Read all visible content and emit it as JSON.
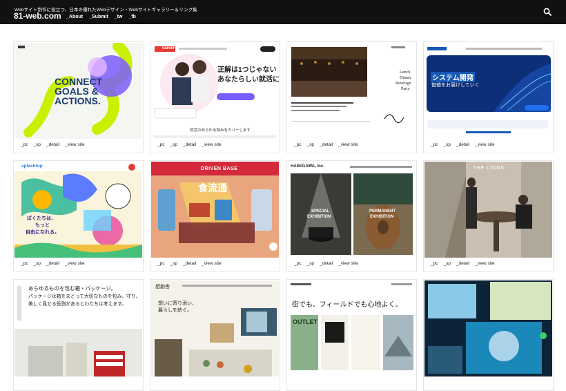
{
  "header": {
    "tagline": "Webサイト制作に役立つ、日本の優れたWebデザイン・Webサイトギャラリー＆リンク集",
    "logo": "81-web.com",
    "nav": [
      "_About",
      "_Submit",
      "_tw",
      "_fb"
    ],
    "search_icon": "search-icon"
  },
  "card_links": [
    "_pc",
    "_sp",
    "_detail",
    "_view site"
  ],
  "cards": [
    {
      "thumb_texts": [
        "CONNECT",
        "GOALS &",
        "ACTIONS."
      ]
    },
    {
      "thumb_texts": [
        "career",
        "正解は1つじゃない",
        "あなたらしい就活に",
        "就活のあらゆる悩みをカバーします"
      ]
    },
    {
      "thumb_texts": [
        "Lunch",
        "Dinner",
        "Beverage",
        "Party"
      ]
    },
    {
      "thumb_texts": [
        "システム開発",
        "で",
        "価値をお届けしていく"
      ]
    },
    {
      "thumb_texts": [
        "splashtop",
        "ぼくたちは、",
        "もっと",
        "自由になれる。"
      ]
    },
    {
      "thumb_texts": [
        "DRIVEN BASE",
        "食流通"
      ]
    },
    {
      "thumb_texts": [
        "HASEGAWA, inc.",
        "SPECIAL",
        "EXHIBITION",
        "PERMANENT",
        "EXHIBITION"
      ]
    },
    {
      "thumb_texts": [
        "THE LIONS"
      ]
    },
    {
      "thumb_texts": [
        "あらゆるものを包む箱・パッケージ。",
        "パッケージは箱をまとって大切なものを包み、守り、",
        "美しく見せる役割があるとわたちは考えます。"
      ]
    },
    {
      "thumb_texts": [
        "想創舎",
        "想いに寄り添い、",
        "暮らしを紡ぐ。"
      ]
    },
    {
      "thumb_texts": [
        "街でも、フィールドでも心地よく。",
        "OUTLET"
      ]
    },
    {
      "thumb_texts": []
    }
  ],
  "colors": {
    "header_bg": "#111111",
    "lime": "#c8f000",
    "purple": "#7b5cff",
    "career_red": "#e8382f",
    "deep_blue": "#1658b8"
  }
}
